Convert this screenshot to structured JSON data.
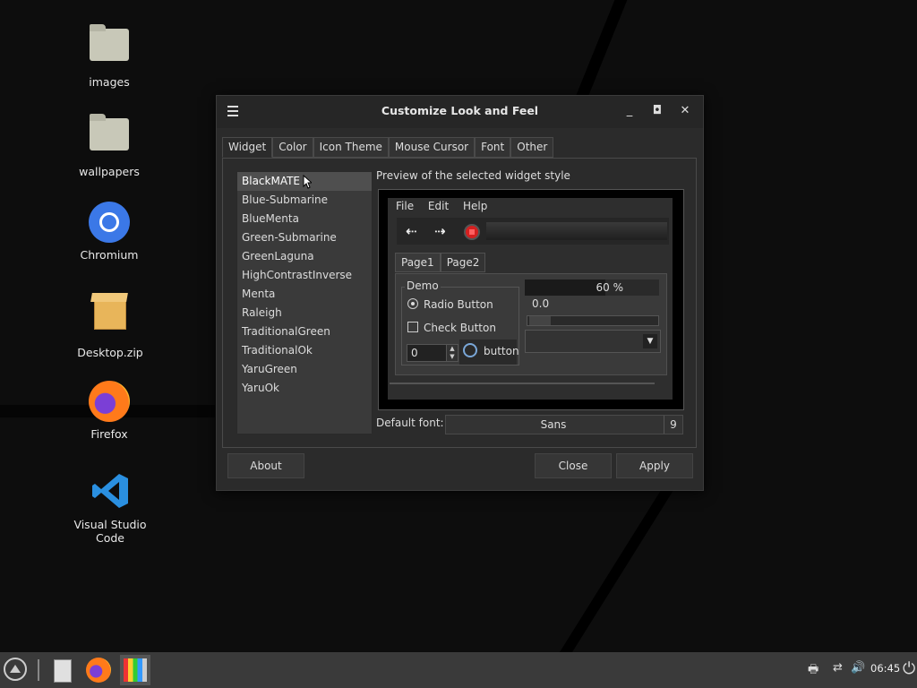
{
  "desktop": {
    "icons": [
      {
        "label": "images",
        "icon": "folder-icon"
      },
      {
        "label": "wallpapers",
        "icon": "folder-icon"
      },
      {
        "label": "Chromium",
        "icon": "chromium-icon"
      },
      {
        "label": "Desktop.zip",
        "icon": "zip-archive-icon"
      },
      {
        "label": "Firefox",
        "icon": "firefox-icon"
      },
      {
        "label": "Visual Studio Code",
        "icon": "vscode-icon"
      }
    ]
  },
  "window": {
    "title": "Customize Look and Feel",
    "tabs": [
      "Widget",
      "Color",
      "Icon Theme",
      "Mouse Cursor",
      "Font",
      "Other"
    ],
    "active_tab": "Widget",
    "styles": [
      "BlackMATE",
      "Blue-Submarine",
      "BlueMenta",
      "Green-Submarine",
      "GreenLaguna",
      "HighContrastInverse",
      "Menta",
      "Raleigh",
      "TraditionalGreen",
      "TraditionalOk",
      "YaruGreen",
      "YaruOk"
    ],
    "selected_style": "BlackMATE",
    "preview_label": "Preview of the selected widget style",
    "preview": {
      "menu": [
        "File",
        "Edit",
        "Help"
      ],
      "tabs": [
        "Page1",
        "Page2"
      ],
      "demo_title": "Demo",
      "radio_label": "Radio Button",
      "check_label": "Check Button",
      "spin_value": "0",
      "button_label": "button",
      "progress_text": "60 %",
      "progress_value": 0.6,
      "scale_value": "0.0"
    },
    "default_font_label": "Default font:",
    "font_name": "Sans",
    "font_size": "9",
    "buttons": {
      "about": "About",
      "close": "Close",
      "apply": "Apply"
    }
  },
  "taskbar": {
    "clock": "06:45"
  }
}
